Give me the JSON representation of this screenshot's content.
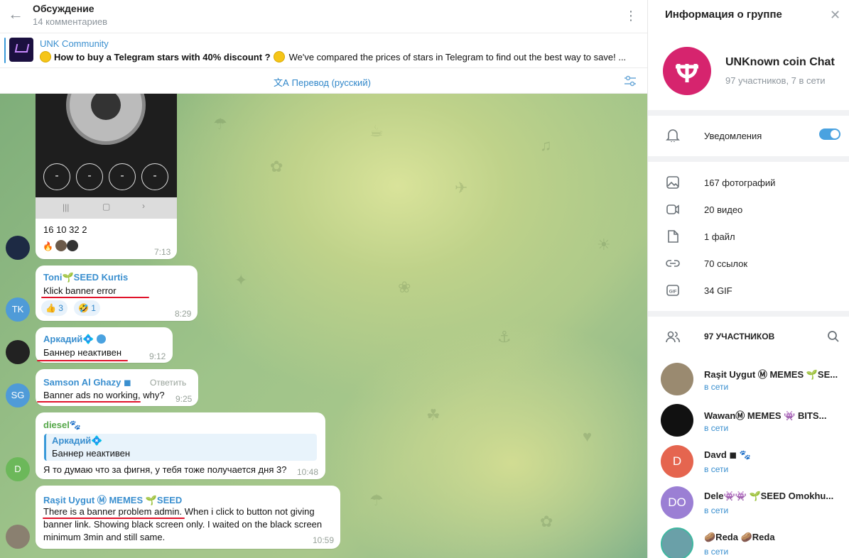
{
  "header": {
    "title": "Обсуждение",
    "subtitle": "14 комментариев"
  },
  "pinned": {
    "title": "UNK Community",
    "text": "How to buy a Telegram stars with 40% discount ?",
    "text2": "We've compared the prices of stars in Telegram to find out the best way to save! ..."
  },
  "translate": {
    "label": "Перевод (русский)"
  },
  "messages": {
    "m0": {
      "keypad": [
        "-",
        "-",
        "-",
        "-"
      ],
      "text": "16 10 32 2",
      "time": "7:13"
    },
    "m1": {
      "author": "Toni🌱SEED Kurtis",
      "avatar": "TK",
      "text": "Klick banner error",
      "r1": "👍 3",
      "r2": "🤣 1",
      "time": "8:29"
    },
    "m2": {
      "author": "Аркадий💠",
      "text": "Баннер неактивен",
      "time": "9:12"
    },
    "m3": {
      "author": "Samson Al Ghazy ◼",
      "avatar": "SG",
      "reply": "Ответить",
      "text": "Banner ads no working",
      "text_tail": ", why?",
      "time": "9:25"
    },
    "m4": {
      "author": "diesel🐾",
      "avatar": "D",
      "quote_author": "Аркадий💠",
      "quote_text": "Баннер неактивен",
      "text": "Я то думаю что за фигня, у тебя тоже получается дня 3?",
      "time": "10:48"
    },
    "m5": {
      "author": "Raşit Uygut Ⓜ MEMES 🌱SEED",
      "text1a": "There is a banner problem admin",
      "text1b": ". When i click to button not giving",
      "text2": "banner link. Showing black screen only. I waited on the black screen",
      "text3": "minimum 3min and still same.",
      "time": "10:59"
    }
  },
  "info": {
    "title": "Информация о группе",
    "group_name": "UNKnown coin Chat",
    "group_sub": "97 участников, 7 в сети",
    "notifications": "Уведомления",
    "media": [
      "167 фотографий",
      "20 видео",
      "1 файл",
      "70 ссылок",
      "34 GIF"
    ],
    "members_header": "97 УЧАСТНИКОВ",
    "members": [
      {
        "name": "Raşit Uygut Ⓜ MEMES 🌱SE...",
        "status": "в сети"
      },
      {
        "name": "WawanⓂ MEMES 👾 BITS...",
        "status": "в сети"
      },
      {
        "name": "Davd ◼ 🐾",
        "avatar": "D",
        "status": "в сети"
      },
      {
        "name": "Dele👾👾 🌱SEED Omokhu...",
        "avatar": "DO",
        "status": "в сети"
      },
      {
        "name": "🥔Reda 🥔Reda",
        "status": "в сети"
      }
    ]
  },
  "colors": {
    "accent": "#3a8fcf",
    "underline": "#e0132a",
    "group_avatar": "#d6246e",
    "toggle": "#4aa2e0"
  }
}
